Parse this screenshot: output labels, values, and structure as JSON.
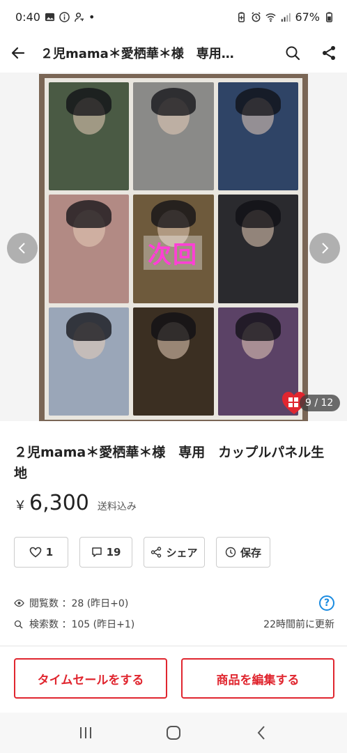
{
  "status_bar": {
    "time": "0:40",
    "dot": "•",
    "battery": "67%",
    "icons_left": [
      "gallery-icon",
      "info-icon",
      "person-key-icon"
    ],
    "icons_right": [
      "battery-saver-icon",
      "alarm-icon",
      "wifi-icon",
      "signal-icon",
      "battery-icon"
    ]
  },
  "header": {
    "title": "２児mama＊愛栖華＊様　専用…",
    "back_icon": "arrow-left-icon",
    "search_icon": "search-icon",
    "share_icon": "share-icon"
  },
  "carousel": {
    "overlay_text": "次回",
    "counter": "9 / 12",
    "tile_colors": [
      "#4a5a44",
      "#8a8a88",
      "#2f4466",
      "#b28a84",
      "#6e5a3c",
      "#2a2a2e",
      "#9aa6b8",
      "#3b2f22",
      "#5b4266"
    ]
  },
  "item": {
    "title": "２児mama＊愛栖華＊様　専用　カップルパネル生地",
    "price_currency": "￥",
    "price_value": "6,300",
    "price_note": "送料込み"
  },
  "actions": {
    "like_count": "1",
    "comment_count": "19",
    "share_label": "シェア",
    "save_label": "保存"
  },
  "stats": {
    "views": "閲覧数 ：28 (昨日+0)",
    "searches": "検索数 ：105 (昨日+1)",
    "updated": "22時間前に更新",
    "help": "?"
  },
  "buttons": {
    "time_sale": "タイムセールをする",
    "edit_item": "商品を編集する"
  },
  "colors": {
    "accent_red": "#e0262f",
    "help_blue": "#1a8be0",
    "overlay_pink": "#ff3fd6"
  }
}
